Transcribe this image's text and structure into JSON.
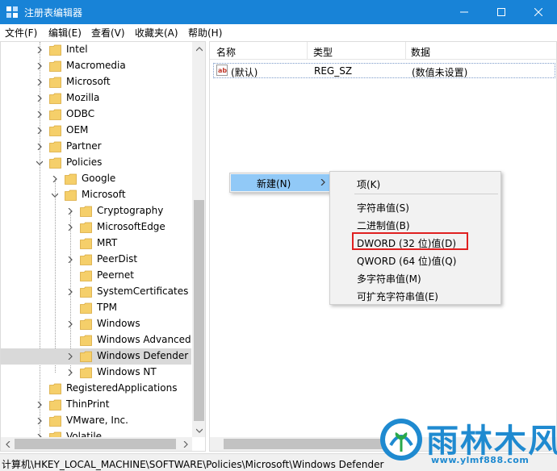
{
  "window": {
    "title": "注册表编辑器",
    "minimize": "—",
    "maximize": "☐",
    "close": "✕"
  },
  "menubar": {
    "items": [
      "文件(F)",
      "编辑(E)",
      "查看(V)",
      "收藏夹(A)",
      "帮助(H)"
    ]
  },
  "tree": {
    "items": [
      {
        "label": "Intel",
        "level": 0,
        "expandable": true,
        "expanded": false
      },
      {
        "label": "Macromedia",
        "level": 0,
        "expandable": true,
        "expanded": false
      },
      {
        "label": "Microsoft",
        "level": 0,
        "expandable": true,
        "expanded": false
      },
      {
        "label": "Mozilla",
        "level": 0,
        "expandable": true,
        "expanded": false
      },
      {
        "label": "ODBC",
        "level": 0,
        "expandable": true,
        "expanded": false
      },
      {
        "label": "OEM",
        "level": 0,
        "expandable": true,
        "expanded": false
      },
      {
        "label": "Partner",
        "level": 0,
        "expandable": true,
        "expanded": false
      },
      {
        "label": "Policies",
        "level": 0,
        "expandable": true,
        "expanded": true
      },
      {
        "label": "Google",
        "level": 1,
        "expandable": true,
        "expanded": false
      },
      {
        "label": "Microsoft",
        "level": 1,
        "expandable": true,
        "expanded": true
      },
      {
        "label": "Cryptography",
        "level": 2,
        "expandable": true,
        "expanded": false
      },
      {
        "label": "MicrosoftEdge",
        "level": 2,
        "expandable": true,
        "expanded": false
      },
      {
        "label": "MRT",
        "level": 2,
        "expandable": false,
        "expanded": false
      },
      {
        "label": "PeerDist",
        "level": 2,
        "expandable": true,
        "expanded": false
      },
      {
        "label": "Peernet",
        "level": 2,
        "expandable": false,
        "expanded": false
      },
      {
        "label": "SystemCertificates",
        "level": 2,
        "expandable": true,
        "expanded": false
      },
      {
        "label": "TPM",
        "level": 2,
        "expandable": false,
        "expanded": false
      },
      {
        "label": "Windows",
        "level": 2,
        "expandable": true,
        "expanded": false
      },
      {
        "label": "Windows Advanced",
        "level": 2,
        "expandable": false,
        "expanded": false
      },
      {
        "label": "Windows Defender",
        "level": 2,
        "expandable": true,
        "expanded": false,
        "selected": true
      },
      {
        "label": "Windows NT",
        "level": 2,
        "expandable": true,
        "expanded": false
      },
      {
        "label": "RegisteredApplications",
        "level": 0,
        "expandable": false,
        "expanded": false
      },
      {
        "label": "ThinPrint",
        "level": 0,
        "expandable": true,
        "expanded": false
      },
      {
        "label": "VMware, Inc.",
        "level": 0,
        "expandable": true,
        "expanded": false
      },
      {
        "label": "Volatile",
        "level": 0,
        "expandable": true,
        "expanded": false
      }
    ]
  },
  "values": {
    "columns": [
      "名称",
      "类型",
      "数据"
    ],
    "rows": [
      {
        "icon": "string-value-icon",
        "name": "(默认)",
        "type": "REG_SZ",
        "data": "(数值未设置)"
      }
    ]
  },
  "context_menu": {
    "parent_label": "新建(N)",
    "items": [
      {
        "label": "项(K)"
      },
      {
        "label": "字符串值(S)"
      },
      {
        "label": "二进制值(B)"
      },
      {
        "label": "DWORD (32 位)值(D)",
        "highlighted": true
      },
      {
        "label": "QWORD (64 位)值(Q)"
      },
      {
        "label": "多字符串值(M)"
      },
      {
        "label": "可扩充字符串值(E)"
      }
    ]
  },
  "status": {
    "path": "计算机\\HKEY_LOCAL_MACHINE\\SOFTWARE\\Policies\\Microsoft\\Windows Defender"
  },
  "watermark": {
    "brand": "雨林木风",
    "url": "www.ylmf888.com"
  },
  "colors": {
    "titlebar": "#1883d7",
    "folder": "#f5cf6a",
    "menu_highlight": "#91c9f7",
    "callout": "#e02020",
    "brand": "#1f8ad0"
  }
}
